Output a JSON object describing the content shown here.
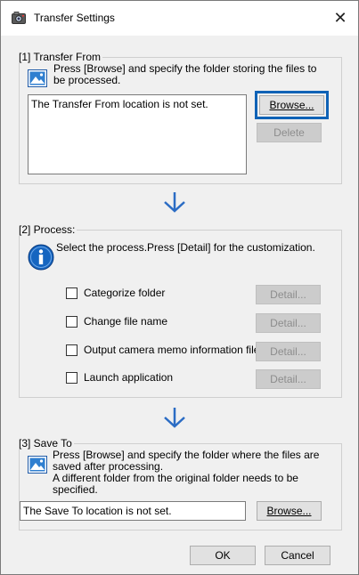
{
  "window": {
    "title": "Transfer Settings",
    "close_glyph": "✕",
    "app_icon": "camera-icon"
  },
  "transfer_from": {
    "label": "[1] Transfer From",
    "description": "Press [Browse] and specify the folder storing the files to be processed.",
    "icon": "image-folder-icon",
    "location_text": "The Transfer From location is not set.",
    "browse_label": "Browse...",
    "delete_label": "Delete"
  },
  "process": {
    "label": "[2] Process:",
    "description": "Select the process.Press [Detail] for the customization.",
    "icon": "info-icon",
    "options": [
      {
        "label": "Categorize folder",
        "checked": false,
        "detail_label": "Detail..."
      },
      {
        "label": "Change file name",
        "checked": false,
        "detail_label": "Detail..."
      },
      {
        "label": "Output camera memo information file",
        "checked": false,
        "detail_label": "Detail..."
      },
      {
        "label": "Launch application",
        "checked": false,
        "detail_label": "Detail..."
      }
    ]
  },
  "save_to": {
    "label": "[3] Save To",
    "description_line1": "Press [Browse] and specify the folder where the files are",
    "description_line2": "saved after processing.",
    "description_line3": "A different folder from the original folder needs to be specified.",
    "icon": "image-folder-icon",
    "location_text": "The Save To location is not set.",
    "browse_label": "Browse..."
  },
  "footer": {
    "ok_label": "OK",
    "cancel_label": "Cancel"
  },
  "colors": {
    "accent_focus": "#0f62b6",
    "arrow": "#2b6cc4",
    "info_icon": "#1565c0"
  }
}
